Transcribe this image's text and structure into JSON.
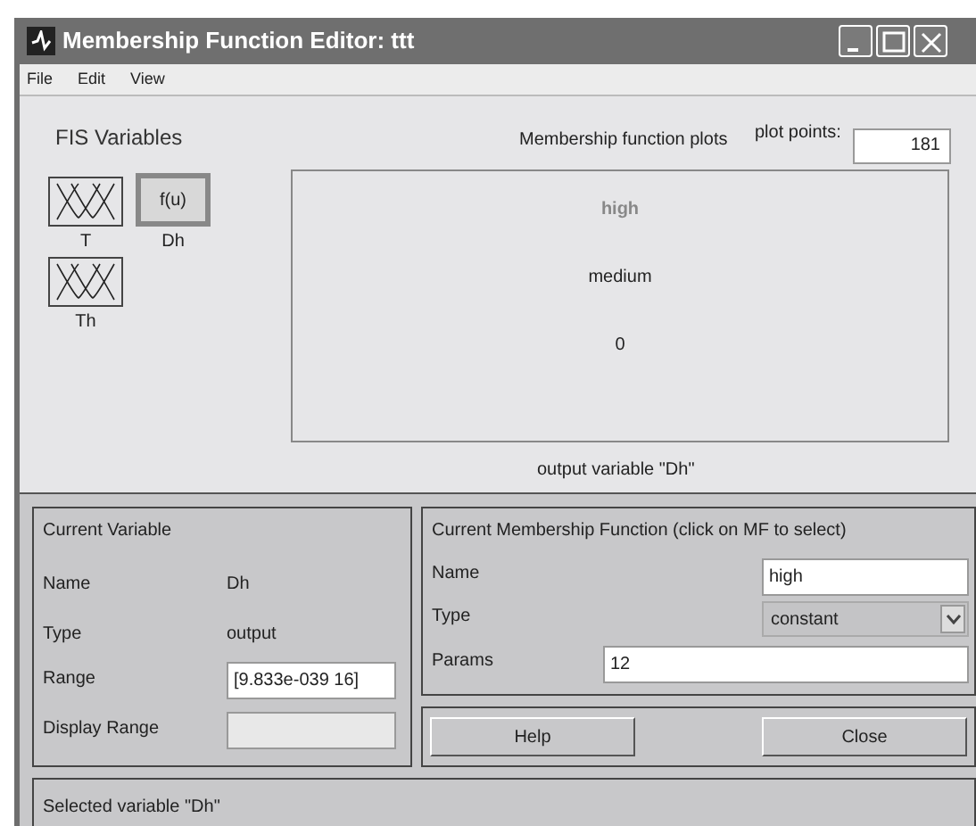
{
  "window": {
    "title": "Membership Function Editor: ttt"
  },
  "menu": [
    "File",
    "Edit",
    "View"
  ],
  "fis_variables": {
    "title": "FIS Variables",
    "items": [
      {
        "label": "T",
        "kind": "mf",
        "selected": false
      },
      {
        "label": "Dh",
        "kind": "func",
        "icon_text": "f(u)",
        "selected": true
      },
      {
        "label": "Th",
        "kind": "mf",
        "selected": false
      }
    ]
  },
  "plot": {
    "title": "Membership function plots",
    "plot_points_label": "plot points:",
    "plot_points": "181",
    "caption": "output variable \"Dh\"",
    "mfs": [
      {
        "label": "high",
        "selected": true
      },
      {
        "label": "medium",
        "selected": false
      },
      {
        "label": "0",
        "selected": false
      }
    ]
  },
  "current_variable": {
    "title": "Current Variable",
    "rows": [
      {
        "label": "Name",
        "kind": "text",
        "value": "Dh"
      },
      {
        "label": "Type",
        "kind": "text",
        "value": "output"
      },
      {
        "label": "Range",
        "kind": "field",
        "value": "[9.833e-039 16]",
        "disabled": false
      },
      {
        "label": "Display Range",
        "kind": "field",
        "disabled": true
      }
    ]
  },
  "current_mf": {
    "title": "Current Membership Function (click on MF to select)",
    "name_label": "Name",
    "name": "high",
    "type_label": "Type",
    "type": "constant",
    "params_label": "Params",
    "params": "12"
  },
  "buttons": [
    "Help",
    "Close"
  ],
  "status": "Selected variable \"Dh\""
}
